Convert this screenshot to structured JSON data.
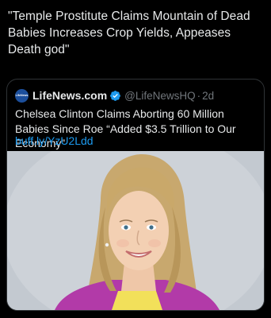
{
  "tweet": {
    "text": "\"Temple Prostitute Claims Mountain of Dead Babies Increases Crop Yields, Appeases Death god\""
  },
  "quoted_tweet": {
    "avatar_text": "LifeNews",
    "display_name": "LifeNews.com",
    "verified_icon": "verified-badge-icon",
    "handle": "@LifeNewsHQ",
    "separator": "·",
    "time": "2d",
    "body": "Chelsea Clinton Claims Aborting 60 Million Babies Since Roe “Added $3.5 Trillion to Our Economy”",
    "link": "buff.ly/YzU2Ldd",
    "image": "portrait-photo"
  },
  "colors": {
    "background": "#000000",
    "text": "#e7e9ea",
    "muted": "#71767b",
    "link": "#1d9bf0",
    "border": "#2f3336",
    "verified": "#1d9bf0"
  }
}
